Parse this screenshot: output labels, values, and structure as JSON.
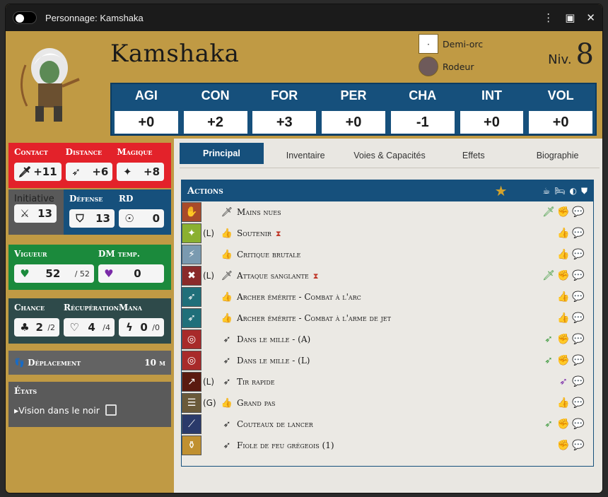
{
  "window": {
    "title": "Personnage: Kamshaka"
  },
  "character": {
    "name": "Kamshaka",
    "race": "Demi-orc",
    "class": "Rodeur",
    "level_label": "Niv.",
    "level": "8"
  },
  "attributes": [
    {
      "key": "AGI",
      "value": "+0"
    },
    {
      "key": "CON",
      "value": "+2"
    },
    {
      "key": "FOR",
      "value": "+3"
    },
    {
      "key": "PER",
      "value": "+0"
    },
    {
      "key": "CHA",
      "value": "-1"
    },
    {
      "key": "INT",
      "value": "+0"
    },
    {
      "key": "VOL",
      "value": "+0"
    }
  ],
  "combat": {
    "contact": {
      "label": "Contact",
      "value": "+11"
    },
    "distance": {
      "label": "Distance",
      "value": "+6"
    },
    "magique": {
      "label": "Magique",
      "value": "+8"
    },
    "initiative": {
      "label": "Initiative",
      "value": "13"
    },
    "defense": {
      "label": "Défense",
      "value": "13"
    },
    "rd": {
      "label": "RD",
      "value": "0"
    }
  },
  "health": {
    "vigueur": {
      "label": "Vigueur",
      "value": "52",
      "max": "/ 52"
    },
    "dm_temp": {
      "label": "DM temp.",
      "value": "0"
    }
  },
  "resources": {
    "chance": {
      "label": "Chance",
      "value": "2",
      "max": "/2"
    },
    "recuperation": {
      "label": "Récupération",
      "value": "4",
      "max": "/4"
    },
    "mana": {
      "label": "Mana",
      "value": "0",
      "max": "/0"
    }
  },
  "movement": {
    "label": "Déplacement",
    "value": "10 m"
  },
  "states": {
    "label": "États",
    "items": [
      "Vision dans le noir"
    ]
  },
  "tabs": [
    "Principal",
    "Inventaire",
    "Voies & Capacités",
    "Effets",
    "Biographie"
  ],
  "actions_panel": {
    "title": "Actions"
  },
  "actions": [
    {
      "tag": "",
      "name": "Mains nues",
      "hourglass": false
    },
    {
      "tag": "(L)",
      "name": "Soutenir",
      "hourglass": true
    },
    {
      "tag": "",
      "name": "Critique brutale",
      "hourglass": false
    },
    {
      "tag": "(L)",
      "name": "Attaque sanglante",
      "hourglass": true
    },
    {
      "tag": "",
      "name": "Archer émérite - Combat à l'arc",
      "hourglass": false
    },
    {
      "tag": "",
      "name": "Archer émérite - Combat à l'arme de jet",
      "hourglass": false
    },
    {
      "tag": "",
      "name": "Dans le mille - (A)",
      "hourglass": false
    },
    {
      "tag": "",
      "name": "Dans le mille - (L)",
      "hourglass": false
    },
    {
      "tag": "(L)",
      "name": "Tir rapide",
      "hourglass": false
    },
    {
      "tag": "(G)",
      "name": "Grand pas",
      "hourglass": false
    },
    {
      "tag": "",
      "name": "Couteaux de lancer",
      "hourglass": false
    },
    {
      "tag": "",
      "name": "Fiole de feu grégeois (1)",
      "hourglass": false
    }
  ],
  "colors": {
    "gold": "#c09a44",
    "blue": "#16507c",
    "red": "#e3222a",
    "green": "#1b8a3c"
  }
}
